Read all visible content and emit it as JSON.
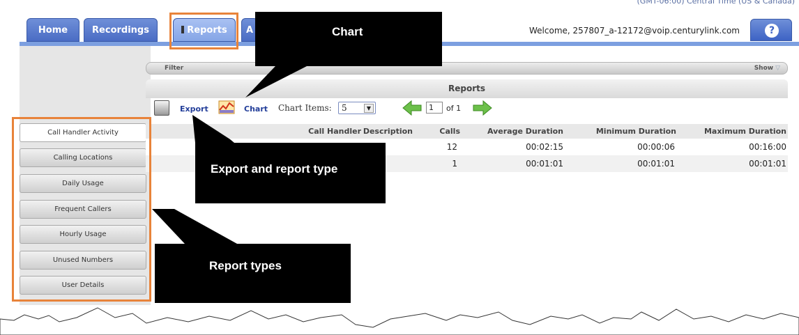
{
  "header": {
    "timezone_text": "(GMT-06:00) Central Time (US & Canada)",
    "welcome_text": "Welcome, 257807_a-12172@voip.centurylink.com",
    "help_label": "?"
  },
  "tabs": [
    {
      "label": "Home"
    },
    {
      "label": "Recordings"
    },
    {
      "label": "Reports"
    },
    {
      "label": "A"
    }
  ],
  "filter": {
    "label": "Filter",
    "show_label": "Show"
  },
  "reports": {
    "title": "Reports",
    "export_label": "Export",
    "chart_label": "Chart",
    "chart_items_label": "Chart Items:",
    "chart_items_value": "5",
    "page_value": "1",
    "page_of": "of 1"
  },
  "sidebar": {
    "items": [
      {
        "label": "Call Handler Activity"
      },
      {
        "label": "Calling Locations"
      },
      {
        "label": "Daily Usage"
      },
      {
        "label": "Frequent Callers"
      },
      {
        "label": "Hourly Usage"
      },
      {
        "label": "Unused Numbers"
      },
      {
        "label": "User Details"
      }
    ]
  },
  "table": {
    "columns": [
      "Call Handler",
      "Description",
      "Calls",
      "Average Duration",
      "Minimum Duration",
      "Maximum Duration"
    ],
    "rows": [
      {
        "call_handler": "",
        "description": "",
        "calls": "12",
        "avg": "00:02:15",
        "min": "00:00:06",
        "max": "00:16:00"
      },
      {
        "call_handler": "",
        "description": "",
        "calls": "1",
        "avg": "00:01:01",
        "min": "00:01:01",
        "max": "00:01:01"
      }
    ]
  },
  "callouts": {
    "chart": "Chart",
    "export": "Export and report type",
    "report_types": "Report types"
  },
  "colors": {
    "accent": "#e8833a",
    "tab_blue": "#4a6cc4",
    "link_blue": "#243f9a"
  }
}
